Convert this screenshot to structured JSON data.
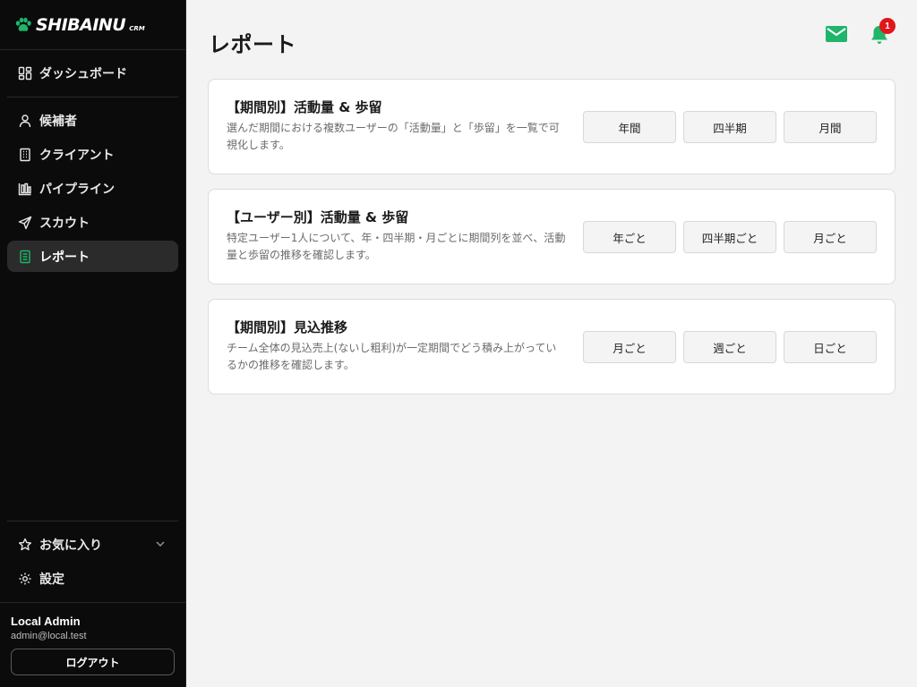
{
  "brand": {
    "name": "SHIBAINU",
    "sub": "CRM",
    "accent": "#1fb56a"
  },
  "sidebar": {
    "dashboard": "ダッシュボード",
    "items": [
      {
        "label": "候補者",
        "icon": "user-icon"
      },
      {
        "label": "クライアント",
        "icon": "building-icon"
      },
      {
        "label": "パイプライン",
        "icon": "pipeline-icon"
      },
      {
        "label": "スカウト",
        "icon": "send-icon"
      },
      {
        "label": "レポート",
        "icon": "report-icon",
        "active": true
      }
    ],
    "favorites": "お気に入り",
    "settings": "設定"
  },
  "user": {
    "name": "Local Admin",
    "email": "admin@local.test",
    "logout": "ログアウト"
  },
  "header": {
    "title": "レポート",
    "notification_count": "1"
  },
  "cards": [
    {
      "title": "【期間別】活動量 & 歩留",
      "description": "選んだ期間における複数ユーザーの「活動量」と「歩留」を一覧で可視化します。",
      "buttons": [
        "年間",
        "四半期",
        "月間"
      ]
    },
    {
      "title": "【ユーザー別】活動量 & 歩留",
      "description": "特定ユーザー1人について、年・四半期・月ごとに期間列を並べ、活動量と歩留の推移を確認します。",
      "buttons": [
        "年ごと",
        "四半期ごと",
        "月ごと"
      ]
    },
    {
      "title": "【期間別】見込推移",
      "description": "チーム全体の見込売上(ないし粗利)が一定期間でどう積み上がっているかの推移を確認します。",
      "buttons": [
        "月ごと",
        "週ごと",
        "日ごと"
      ]
    }
  ]
}
